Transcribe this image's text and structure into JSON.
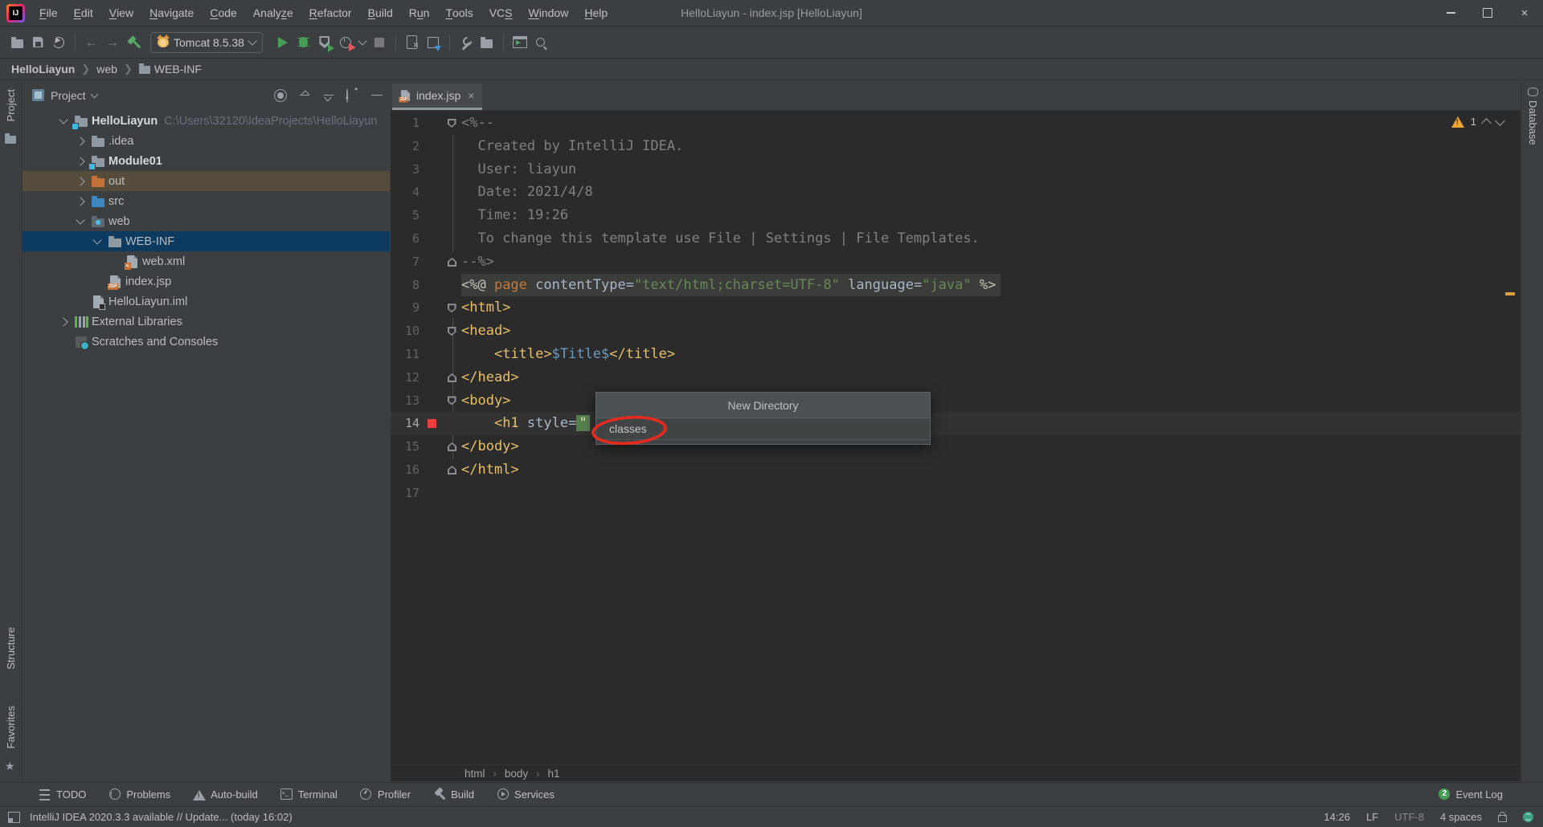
{
  "window": {
    "title": "HelloLiayun - index.jsp [HelloLiayun]"
  },
  "menu": {
    "items": [
      {
        "label": "File",
        "m": 0
      },
      {
        "label": "Edit",
        "m": 0
      },
      {
        "label": "View",
        "m": 0
      },
      {
        "label": "Navigate",
        "m": 0
      },
      {
        "label": "Code",
        "m": 0
      },
      {
        "label": "Analyze",
        "m": 5
      },
      {
        "label": "Refactor",
        "m": 0
      },
      {
        "label": "Build",
        "m": 0
      },
      {
        "label": "Run",
        "m": 1
      },
      {
        "label": "Tools",
        "m": 0
      },
      {
        "label": "VCS",
        "m": 2
      },
      {
        "label": "Window",
        "m": 0
      },
      {
        "label": "Help",
        "m": 0
      }
    ]
  },
  "toolbar": {
    "run_config": "Tomcat 8.5.38"
  },
  "navbar": {
    "crumbs": [
      "HelloLiayun",
      "web",
      "WEB-INF"
    ]
  },
  "left_stripe": {
    "project": "Project",
    "structure": "Structure",
    "favorites": "Favorites"
  },
  "right_stripe": {
    "database": "Database"
  },
  "project_panel": {
    "title": "Project",
    "tree": [
      {
        "label": "HelloLiayun",
        "suffix": "C:\\Users\\32120\\IdeaProjects\\HelloLiayun",
        "icon": "project-folder",
        "indent": 0,
        "chev": "down",
        "bold": true
      },
      {
        "label": ".idea",
        "icon": "folder",
        "indent": 1,
        "chev": "right"
      },
      {
        "label": "Module01",
        "icon": "module-folder",
        "indent": 1,
        "chev": "right",
        "bold": true
      },
      {
        "label": "out",
        "icon": "excluded-folder",
        "indent": 1,
        "chev": "right",
        "hover": true
      },
      {
        "label": "src",
        "icon": "source-folder",
        "indent": 1,
        "chev": "right"
      },
      {
        "label": "web",
        "icon": "web-folder",
        "indent": 1,
        "chev": "down"
      },
      {
        "label": "WEB-INF",
        "icon": "folder",
        "indent": 2,
        "chev": "down",
        "selected": true
      },
      {
        "label": "web.xml",
        "icon": "webxml-file",
        "indent": 3
      },
      {
        "label": "index.jsp",
        "icon": "jsp-file",
        "indent": 2
      },
      {
        "label": "HelloLiayun.iml",
        "icon": "iml-file",
        "indent": 1
      },
      {
        "label": "External Libraries",
        "icon": "libraries",
        "indent": 0,
        "chev": "right"
      },
      {
        "label": "Scratches and Consoles",
        "icon": "scratches",
        "indent": 0
      }
    ]
  },
  "editor": {
    "tab": "index.jsp",
    "inspection": {
      "warning_count": "1"
    },
    "popup": {
      "title": "New Directory",
      "item": "classes"
    },
    "breadcrumbs": [
      "html",
      "body",
      "h1"
    ],
    "code_lines": [
      {
        "n": "1",
        "fold": "down",
        "seg": [
          [
            "<%--",
            "cmt"
          ]
        ]
      },
      {
        "n": "2",
        "seg": [
          [
            "  Created by IntelliJ IDEA.",
            "cmt"
          ]
        ]
      },
      {
        "n": "3",
        "seg": [
          [
            "  User: liayun",
            "cmt"
          ]
        ]
      },
      {
        "n": "4",
        "seg": [
          [
            "  Date: 2021/4/8",
            "cmt"
          ]
        ]
      },
      {
        "n": "5",
        "seg": [
          [
            "  Time: 19:26",
            "cmt"
          ]
        ]
      },
      {
        "n": "6",
        "seg": [
          [
            "  To change this template use File | Settings | File Templates.",
            "cmt"
          ]
        ]
      },
      {
        "n": "7",
        "fold": "up",
        "seg": [
          [
            "--%>",
            "cmt"
          ]
        ]
      },
      {
        "n": "8",
        "band": true,
        "seg": [
          [
            "<%@ ",
            "dir"
          ],
          [
            "page",
            "kw"
          ],
          [
            " contentType=",
            "pln"
          ],
          [
            "\"text/html;charset=UTF-8\"",
            "str"
          ],
          [
            " language=",
            "pln"
          ],
          [
            "\"java\"",
            "str"
          ],
          [
            " %>",
            "dir"
          ]
        ]
      },
      {
        "n": "9",
        "fold": "down",
        "seg": [
          [
            "<html>",
            "tag"
          ]
        ]
      },
      {
        "n": "10",
        "fold": "down",
        "seg": [
          [
            "<head>",
            "tag"
          ]
        ]
      },
      {
        "n": "11",
        "seg": [
          [
            "    ",
            "pln"
          ],
          [
            "<title>",
            "tag"
          ],
          [
            "$Title$",
            "var"
          ],
          [
            "</title>",
            "tag"
          ]
        ]
      },
      {
        "n": "12",
        "fold": "up",
        "seg": [
          [
            "</head>",
            "tag"
          ]
        ]
      },
      {
        "n": "13",
        "fold": "down",
        "seg": [
          [
            "<body>",
            "tag"
          ]
        ]
      },
      {
        "n": "14",
        "caret": true,
        "marker": "red",
        "seg": [
          [
            "    ",
            "pln"
          ],
          [
            "<h1 ",
            "tag"
          ],
          [
            "style=",
            "pln"
          ],
          [
            "\"",
            "strsel"
          ]
        ]
      },
      {
        "n": "15",
        "fold": "up",
        "seg": [
          [
            "</body>",
            "tag"
          ]
        ]
      },
      {
        "n": "16",
        "fold": "up",
        "seg": [
          [
            "</html>",
            "tag"
          ]
        ]
      },
      {
        "n": "17",
        "seg": []
      }
    ]
  },
  "bottom_bar": {
    "items": [
      {
        "label": "TODO",
        "icon": "todo"
      },
      {
        "label": "Problems",
        "icon": "problems"
      },
      {
        "label": "Auto-build",
        "icon": "auto"
      },
      {
        "label": "Terminal",
        "icon": "term"
      },
      {
        "label": "Profiler",
        "icon": "prof"
      },
      {
        "label": "Build",
        "icon": "build"
      },
      {
        "label": "Services",
        "icon": "serv"
      }
    ],
    "event_log": {
      "count": "2",
      "label": "Event Log"
    }
  },
  "status_bar": {
    "message": "IntelliJ IDEA 2020.3.3 available // Update... (today 16:02)",
    "caret_position": "14:26",
    "line_separator": "LF",
    "encoding": "UTF-8",
    "indent": "4 spaces"
  },
  "colors": {
    "selection_blue": "#0d3a5f",
    "annotation_red": "#e32b1e",
    "warning_yellow": "#f0a732",
    "run_green": "#499c54",
    "string_green": "#6a8759",
    "tag_yellow": "#e8bf6a",
    "keyword_orange": "#cc7832",
    "comment_gray": "#808080",
    "excluded_row_brown": "#554c3c"
  }
}
